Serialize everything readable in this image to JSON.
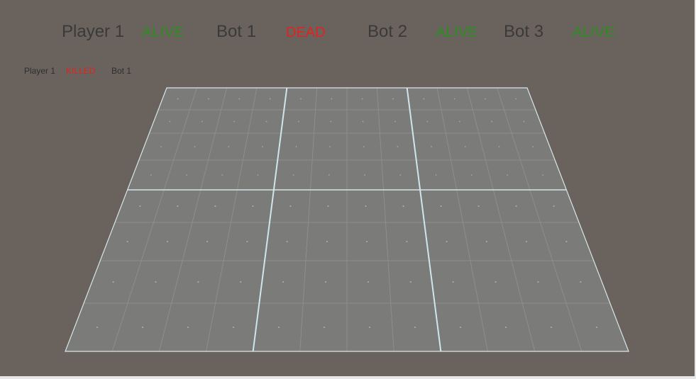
{
  "scoreboard": {
    "players": [
      {
        "name": "Player 1",
        "status": "ALIVE"
      },
      {
        "name": "Bot 1",
        "status": "DEAD"
      },
      {
        "name": "Bot 2",
        "status": "ALIVE"
      },
      {
        "name": "Bot 3",
        "status": "ALIVE"
      }
    ]
  },
  "kill_feed": {
    "killer": "Player 1",
    "action": "KILLED",
    "victim": "Bot 1"
  },
  "colors": {
    "background": "#6a635d",
    "floor": "#7b7b79",
    "alive": "#2e8b22",
    "dead": "#e0231f"
  },
  "board": {
    "tile_columns": 3,
    "tile_rows": 2,
    "cells_per_tile": 4
  }
}
